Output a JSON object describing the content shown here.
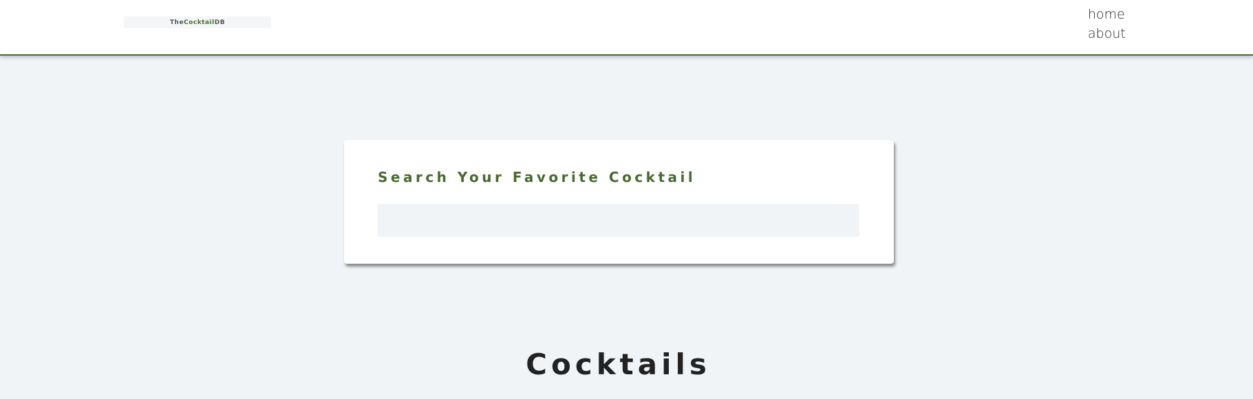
{
  "navbar": {
    "logo": {
      "prefix": "The",
      "accent": "Cocktail",
      "suffix": "DB"
    },
    "links": [
      {
        "label": "home"
      },
      {
        "label": "about"
      }
    ]
  },
  "search": {
    "label": "Search Your Favorite Cocktail",
    "value": "",
    "placeholder": ""
  },
  "main": {
    "section_title": "Cocktails"
  },
  "colors": {
    "accent": "#476a2e",
    "background": "#f0f4f7",
    "card": "#ffffff",
    "text": "#222222"
  }
}
